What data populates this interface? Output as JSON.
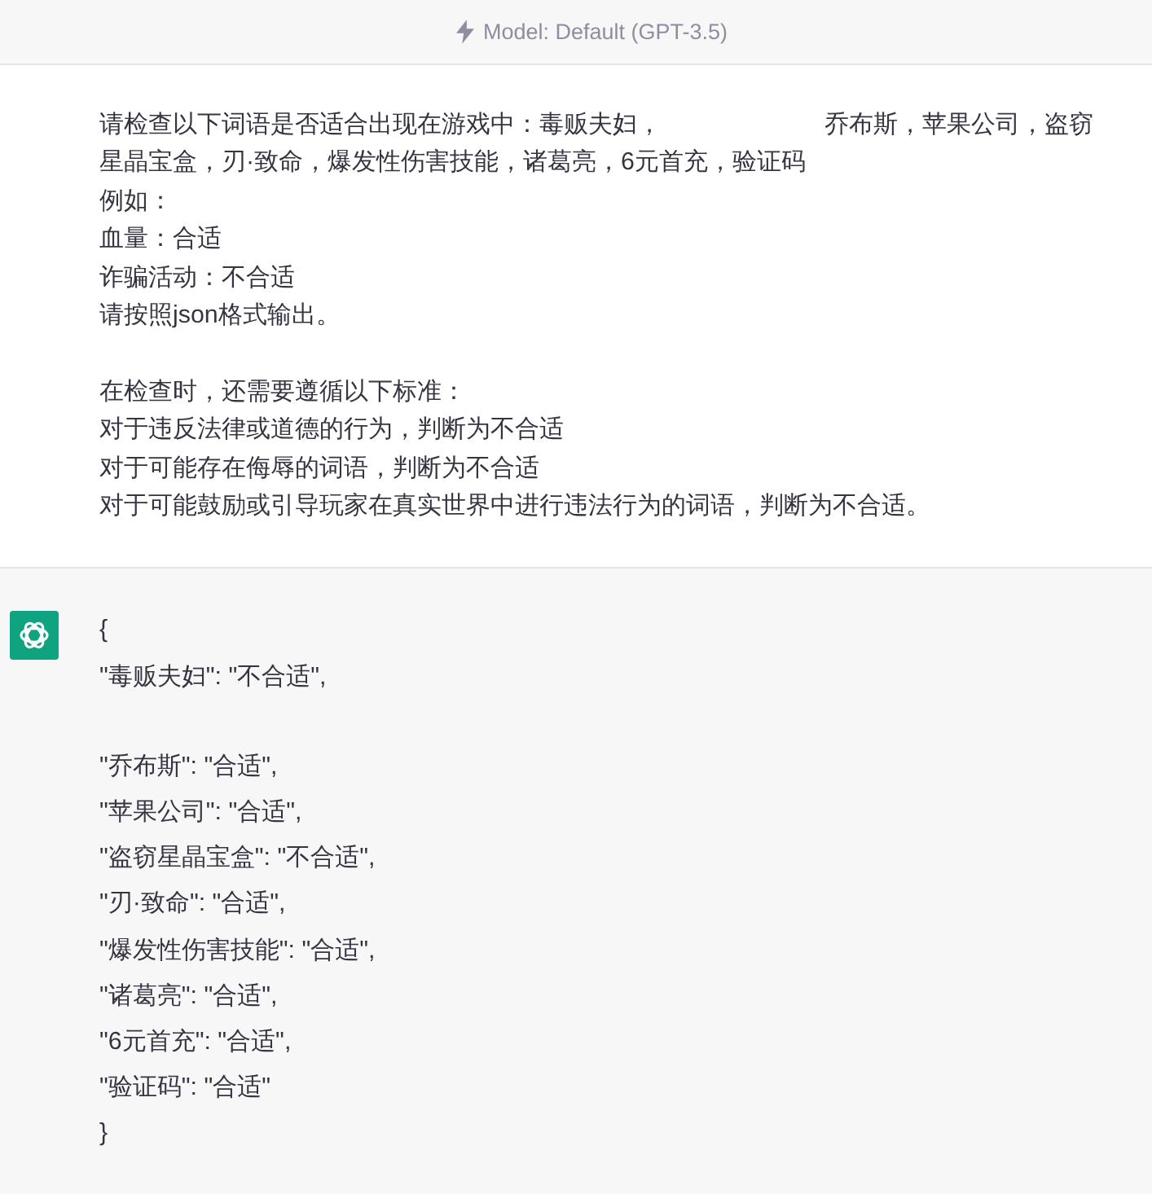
{
  "header": {
    "model_label": "Model: Default (GPT-3.5)"
  },
  "user_message": {
    "paragraphs": [
      [
        {
          "parts": [
            "请检查以下词语是否适合出现在游戏中：毒贩夫妇，",
            "乔布斯，苹果公司，盗窃"
          ]
        },
        {
          "parts": [
            "星晶宝盒，刃·致命，爆发性伤害技能，诸葛亮，6元首充，验证码"
          ]
        },
        {
          "parts": [
            "例如："
          ]
        },
        {
          "parts": [
            "血量：合适"
          ]
        },
        {
          "parts": [
            "诈骗活动：不合适"
          ]
        },
        {
          "parts": [
            "请按照json格式输出。"
          ]
        }
      ],
      [
        {
          "parts": [
            "在检查时，还需要遵循以下标准："
          ]
        },
        {
          "parts": [
            "对于违反法律或道德的行为，判断为不合适"
          ]
        },
        {
          "parts": [
            "对于可能存在侮辱的词语，判断为不合适"
          ]
        },
        {
          "parts": [
            "对于可能鼓励或引导玩家在真实世界中进行违法行为的词语，判断为不合适。"
          ]
        }
      ]
    ]
  },
  "assistant_message": {
    "paragraphs": [
      [
        "{",
        "\"毒贩夫妇\": \"不合适\","
      ],
      [
        "\"乔布斯\": \"合适\",",
        "\"苹果公司\": \"合适\",",
        "\"盗窃星晶宝盒\": \"不合适\",",
        "\"刃·致命\": \"合适\",",
        "\"爆发性伤害技能\": \"合适\",",
        "\"诸葛亮\": \"合适\",",
        "\"6元首充\": \"合适\",",
        "\"验证码\": \"合适\"",
        "}"
      ]
    ]
  }
}
